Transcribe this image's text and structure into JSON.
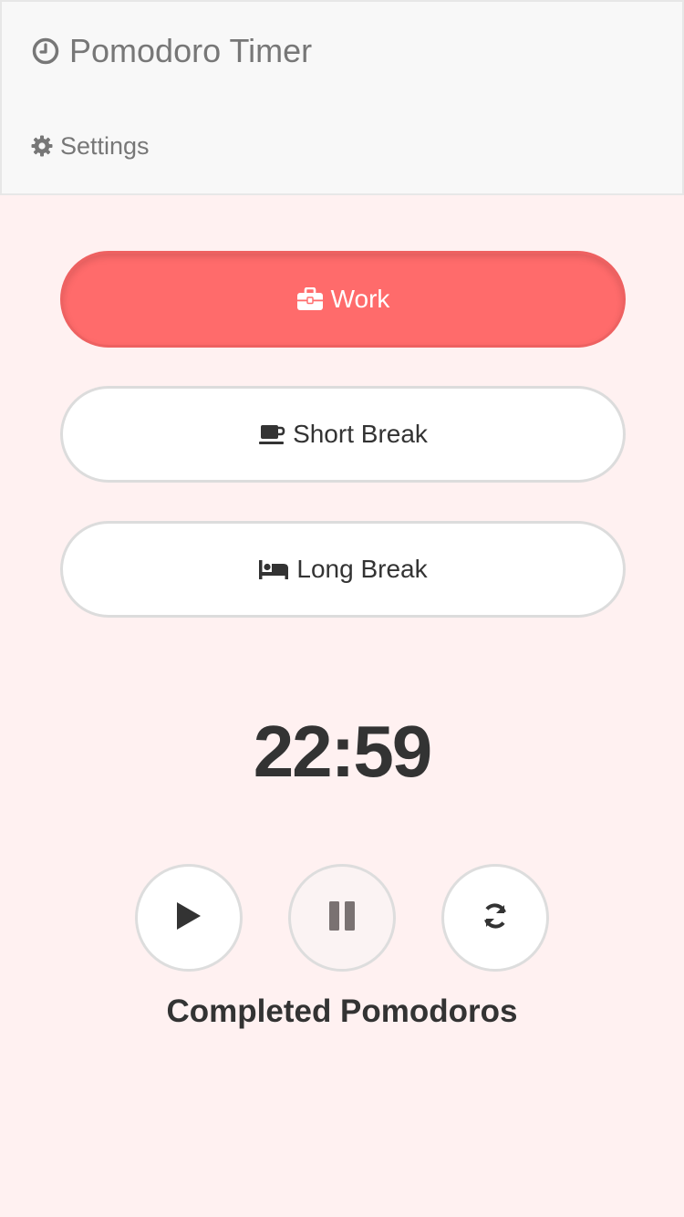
{
  "header": {
    "title": "Pomodoro Timer",
    "title_icon": "clock-icon",
    "settings_label": "Settings",
    "settings_icon": "gear-icon"
  },
  "modes": [
    {
      "label": "Work",
      "icon": "briefcase-icon",
      "active": true
    },
    {
      "label": "Short Break",
      "icon": "coffee-cup-icon",
      "active": false
    },
    {
      "label": "Long Break",
      "icon": "bed-icon",
      "active": false
    }
  ],
  "timer": {
    "display": "22:59"
  },
  "controls": [
    {
      "name": "start",
      "icon": "play-icon",
      "enabled": true
    },
    {
      "name": "pause",
      "icon": "pause-icon",
      "enabled": false
    },
    {
      "name": "reset",
      "icon": "refresh-icon",
      "enabled": true
    }
  ],
  "stats": {
    "completed_label": "Completed Pomodoros"
  },
  "colors": {
    "accent": "#ff6b6b",
    "page_background": "#fff1f1",
    "header_background": "#f8f8f8",
    "text": "#333333",
    "muted_text": "#777777"
  }
}
